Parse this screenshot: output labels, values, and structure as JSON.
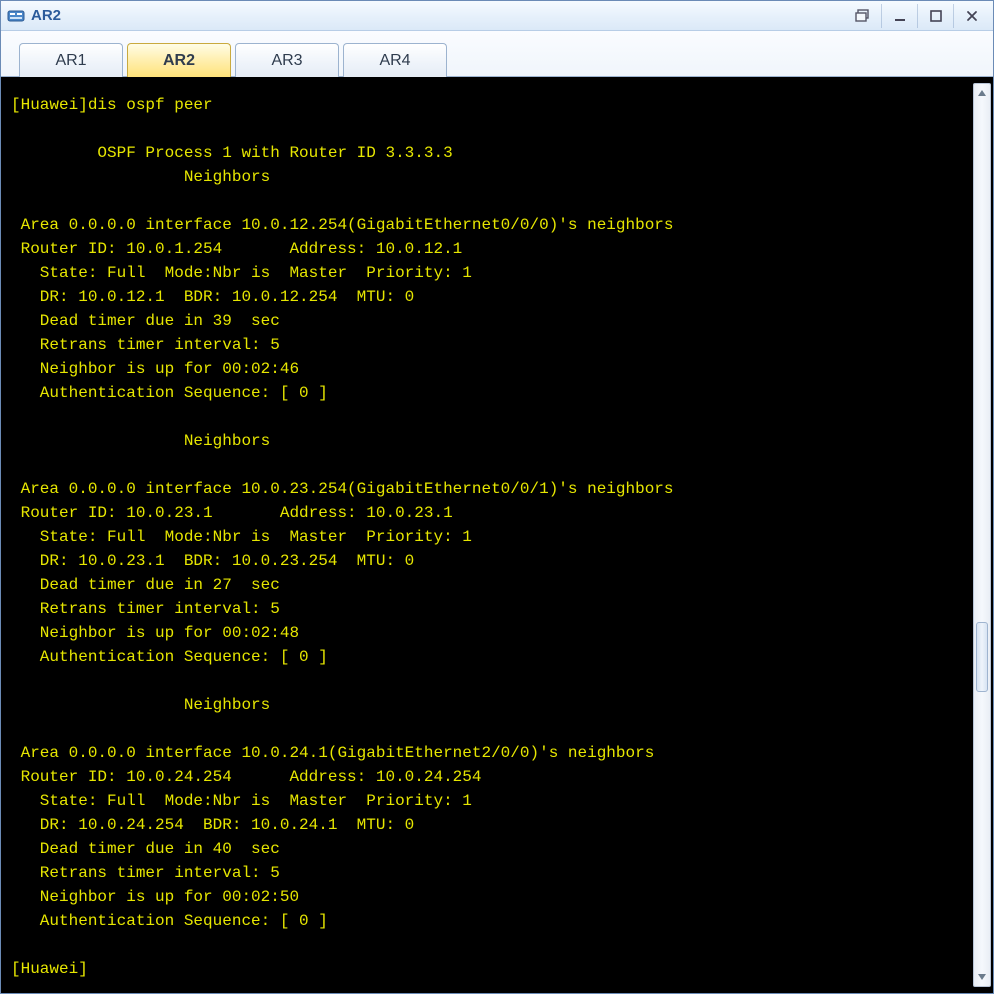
{
  "window": {
    "title": "AR2"
  },
  "tabs": [
    {
      "label": "AR1",
      "active": false
    },
    {
      "label": "AR2",
      "active": true
    },
    {
      "label": "AR3",
      "active": false
    },
    {
      "label": "AR4",
      "active": false
    }
  ],
  "terminal": {
    "prompt_line": "[Huawei]dis ospf peer",
    "process_line": "\t OSPF Process 1 with Router ID 3.3.3.3",
    "neighbors_label": "\t\t  Neighbors ",
    "areas": [
      {
        "header": " Area 0.0.0.0 interface 10.0.12.254(GigabitEthernet0/0/0)'s neighbors",
        "router": " Router ID: 10.0.1.254       Address: 10.0.12.1        ",
        "state": "   State: Full  Mode:Nbr is  Master  Priority: 1",
        "drbdr": "   DR: 10.0.12.1  BDR: 10.0.12.254  MTU: 0    ",
        "dead": "   Dead timer due in 39  sec",
        "retrans": "   Retrans timer interval: 5",
        "uptime": "   Neighbor is up for 00:02:46",
        "auth": "   Authentication Sequence: [ 0 ]"
      },
      {
        "header": " Area 0.0.0.0 interface 10.0.23.254(GigabitEthernet0/0/1)'s neighbors",
        "router": " Router ID: 10.0.23.1       Address: 10.0.23.1         ",
        "state": "   State: Full  Mode:Nbr is  Master  Priority: 1",
        "drbdr": "   DR: 10.0.23.1  BDR: 10.0.23.254  MTU: 0    ",
        "dead": "   Dead timer due in 27  sec",
        "retrans": "   Retrans timer interval: 5",
        "uptime": "   Neighbor is up for 00:02:48",
        "auth": "   Authentication Sequence: [ 0 ]"
      },
      {
        "header": " Area 0.0.0.0 interface 10.0.24.1(GigabitEthernet2/0/0)'s neighbors",
        "router": " Router ID: 10.0.24.254      Address: 10.0.24.254       ",
        "state": "   State: Full  Mode:Nbr is  Master  Priority: 1",
        "drbdr": "   DR: 10.0.24.254  BDR: 10.0.24.1  MTU: 0    ",
        "dead": "   Dead timer due in 40  sec",
        "retrans": "   Retrans timer interval: 5",
        "uptime": "   Neighbor is up for 00:02:50",
        "auth": "   Authentication Sequence: [ 0 ]"
      }
    ],
    "final_prompt": "[Huawei]"
  }
}
